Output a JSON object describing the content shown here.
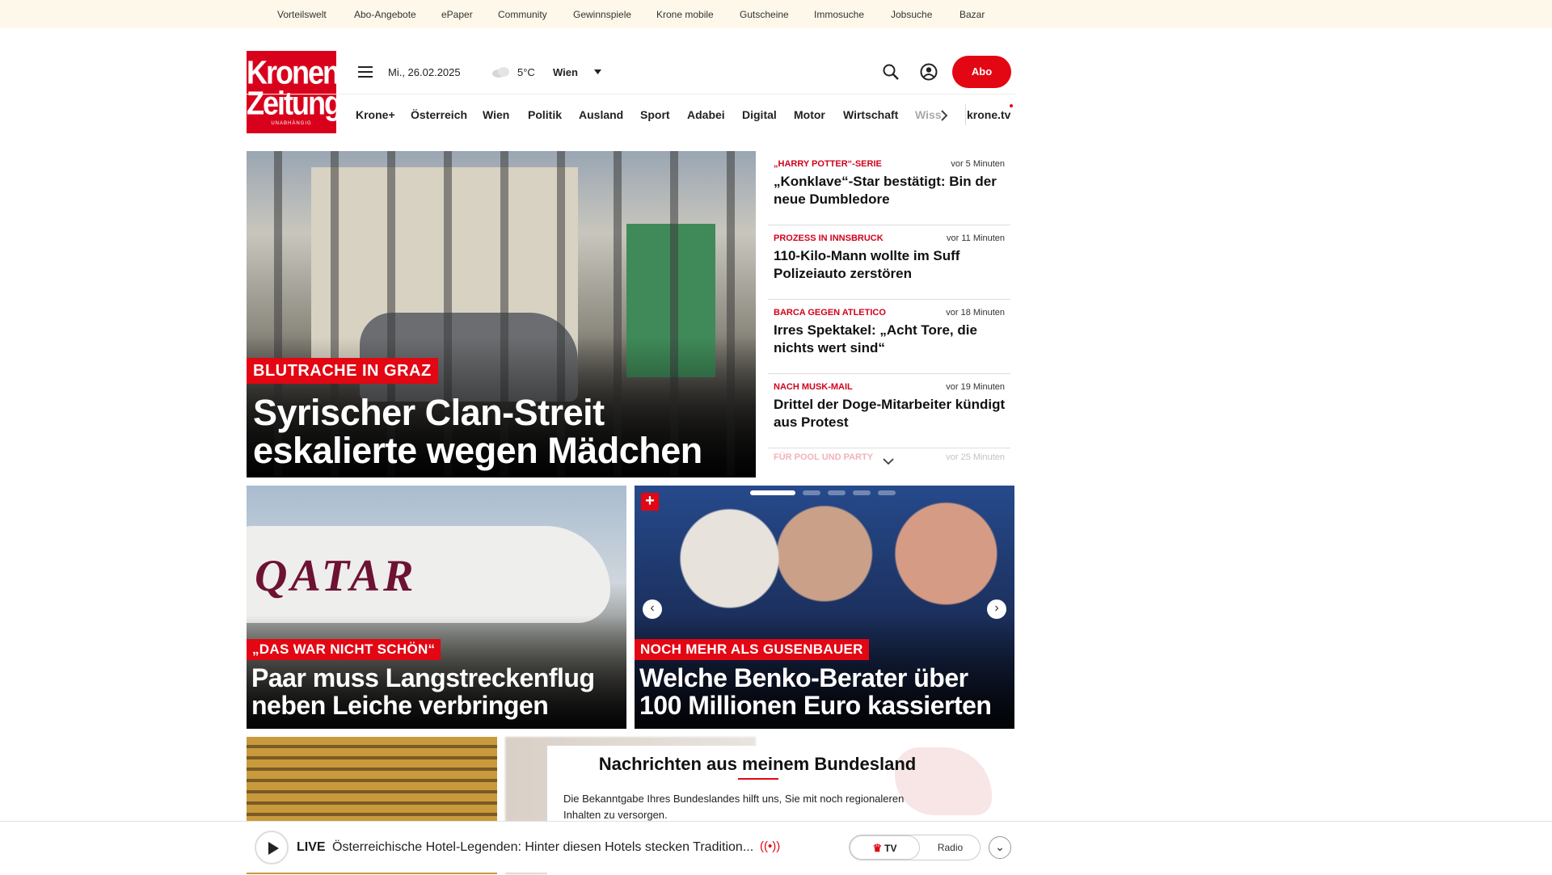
{
  "topbar": {
    "links": [
      "Vorteilswelt",
      "Abo-Angebote",
      "ePaper",
      "Community",
      "Gewinnspiele",
      "Krone mobile",
      "Gutscheine",
      "Immosuche",
      "Jobsuche",
      "Bazar"
    ]
  },
  "logo": {
    "line1": "Kronen",
    "line2": "Zeitung",
    "tagline": "UNABHÄNGIG"
  },
  "header": {
    "date": "Mi., 26.02.2025",
    "temperature": "5°C",
    "location": "Wien",
    "abo_label": "Abo",
    "icons": {
      "menu": "hamburger-icon",
      "weather": "cloud-icon",
      "search": "search-icon",
      "account": "user-icon"
    }
  },
  "nav": {
    "items": [
      "Krone+",
      "Österreich",
      "Wien",
      "Politik",
      "Ausland",
      "Sport",
      "Adabei",
      "Digital",
      "Motor",
      "Wirtschaft"
    ],
    "overflow": "Wiss",
    "tv": "krone.tv"
  },
  "hero": {
    "kicker": "BLUTRACHE IN GRAZ",
    "headline_line1": "Syrischer Clan-Streit",
    "headline_line2": "eskalierte wegen Mädchen"
  },
  "news": [
    {
      "category": "„HARRY POTTER“-SERIE",
      "time": "vor 5 Minuten",
      "title": "„Konklave“-Star bestätigt: Bin der neue Dumbledore"
    },
    {
      "category": "PROZESS IN INNSBRUCK",
      "time": "vor 11 Minuten",
      "title": "110-Kilo-Mann wollte im Suff Polizeiauto zerstören"
    },
    {
      "category": "BARCA GEGEN ATLETICO",
      "time": "vor 18 Minuten",
      "title": "Irres Spektakel: „Acht Tore, die nichts wert sind“"
    },
    {
      "category": "NACH MUSK-MAIL",
      "time": "vor 19 Minuten",
      "title": "Drittel der Doge-Mitarbeiter kündigt aus Protest"
    }
  ],
  "news_faded": {
    "category": "FÜR POOL UND PARTY",
    "time": "vor 25 Minuten"
  },
  "card1": {
    "image_text": "QATAR",
    "kicker": "„DAS WAR NICHT SCHÖN“",
    "headline_line1": "Paar muss Langstreckenflug",
    "headline_line2": "neben Leiche verbringen"
  },
  "card2": {
    "badge": "+",
    "kicker": "NOCH MEHR ALS GUSENBAUER",
    "headline_line1": "Welche Benko-Berater über",
    "headline_line2": "100 Millionen Euro kassierten"
  },
  "bundesland": {
    "title": "Nachrichten aus meinem Bundesland",
    "text": "Die Bekanntgabe Ihres Bundeslandes hilft uns, Sie mit noch regionaleren Inhalten zu versorgen."
  },
  "player": {
    "live_label": "LIVE",
    "text": "Österreichische Hotel-Legenden: Hinter diesen Hotels stecken Tradition...",
    "tv_label": "TV",
    "radio_label": "Radio"
  }
}
